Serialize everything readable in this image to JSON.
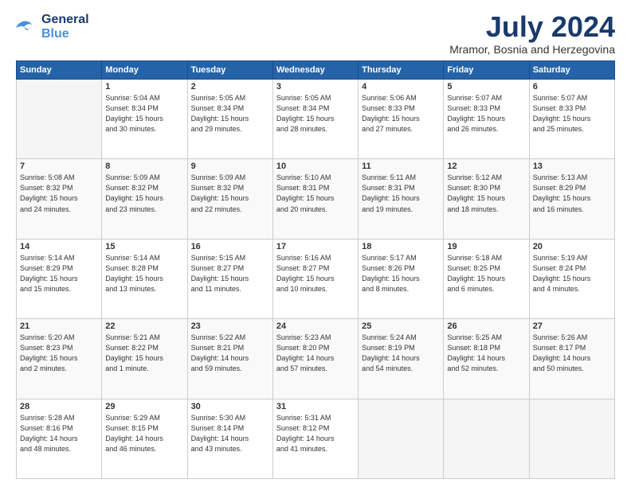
{
  "logo": {
    "line1": "General",
    "line2": "Blue"
  },
  "title": "July 2024",
  "location": "Mramor, Bosnia and Herzegovina",
  "weekdays": [
    "Sunday",
    "Monday",
    "Tuesday",
    "Wednesday",
    "Thursday",
    "Friday",
    "Saturday"
  ],
  "weeks": [
    [
      {
        "day": "",
        "info": ""
      },
      {
        "day": "1",
        "info": "Sunrise: 5:04 AM\nSunset: 8:34 PM\nDaylight: 15 hours\nand 30 minutes."
      },
      {
        "day": "2",
        "info": "Sunrise: 5:05 AM\nSunset: 8:34 PM\nDaylight: 15 hours\nand 29 minutes."
      },
      {
        "day": "3",
        "info": "Sunrise: 5:05 AM\nSunset: 8:34 PM\nDaylight: 15 hours\nand 28 minutes."
      },
      {
        "day": "4",
        "info": "Sunrise: 5:06 AM\nSunset: 8:33 PM\nDaylight: 15 hours\nand 27 minutes."
      },
      {
        "day": "5",
        "info": "Sunrise: 5:07 AM\nSunset: 8:33 PM\nDaylight: 15 hours\nand 26 minutes."
      },
      {
        "day": "6",
        "info": "Sunrise: 5:07 AM\nSunset: 8:33 PM\nDaylight: 15 hours\nand 25 minutes."
      }
    ],
    [
      {
        "day": "7",
        "info": "Sunrise: 5:08 AM\nSunset: 8:32 PM\nDaylight: 15 hours\nand 24 minutes."
      },
      {
        "day": "8",
        "info": "Sunrise: 5:09 AM\nSunset: 8:32 PM\nDaylight: 15 hours\nand 23 minutes."
      },
      {
        "day": "9",
        "info": "Sunrise: 5:09 AM\nSunset: 8:32 PM\nDaylight: 15 hours\nand 22 minutes."
      },
      {
        "day": "10",
        "info": "Sunrise: 5:10 AM\nSunset: 8:31 PM\nDaylight: 15 hours\nand 20 minutes."
      },
      {
        "day": "11",
        "info": "Sunrise: 5:11 AM\nSunset: 8:31 PM\nDaylight: 15 hours\nand 19 minutes."
      },
      {
        "day": "12",
        "info": "Sunrise: 5:12 AM\nSunset: 8:30 PM\nDaylight: 15 hours\nand 18 minutes."
      },
      {
        "day": "13",
        "info": "Sunrise: 5:13 AM\nSunset: 8:29 PM\nDaylight: 15 hours\nand 16 minutes."
      }
    ],
    [
      {
        "day": "14",
        "info": "Sunrise: 5:14 AM\nSunset: 8:29 PM\nDaylight: 15 hours\nand 15 minutes."
      },
      {
        "day": "15",
        "info": "Sunrise: 5:14 AM\nSunset: 8:28 PM\nDaylight: 15 hours\nand 13 minutes."
      },
      {
        "day": "16",
        "info": "Sunrise: 5:15 AM\nSunset: 8:27 PM\nDaylight: 15 hours\nand 11 minutes."
      },
      {
        "day": "17",
        "info": "Sunrise: 5:16 AM\nSunset: 8:27 PM\nDaylight: 15 hours\nand 10 minutes."
      },
      {
        "day": "18",
        "info": "Sunrise: 5:17 AM\nSunset: 8:26 PM\nDaylight: 15 hours\nand 8 minutes."
      },
      {
        "day": "19",
        "info": "Sunrise: 5:18 AM\nSunset: 8:25 PM\nDaylight: 15 hours\nand 6 minutes."
      },
      {
        "day": "20",
        "info": "Sunrise: 5:19 AM\nSunset: 8:24 PM\nDaylight: 15 hours\nand 4 minutes."
      }
    ],
    [
      {
        "day": "21",
        "info": "Sunrise: 5:20 AM\nSunset: 8:23 PM\nDaylight: 15 hours\nand 2 minutes."
      },
      {
        "day": "22",
        "info": "Sunrise: 5:21 AM\nSunset: 8:22 PM\nDaylight: 15 hours\nand 1 minute."
      },
      {
        "day": "23",
        "info": "Sunrise: 5:22 AM\nSunset: 8:21 PM\nDaylight: 14 hours\nand 59 minutes."
      },
      {
        "day": "24",
        "info": "Sunrise: 5:23 AM\nSunset: 8:20 PM\nDaylight: 14 hours\nand 57 minutes."
      },
      {
        "day": "25",
        "info": "Sunrise: 5:24 AM\nSunset: 8:19 PM\nDaylight: 14 hours\nand 54 minutes."
      },
      {
        "day": "26",
        "info": "Sunrise: 5:25 AM\nSunset: 8:18 PM\nDaylight: 14 hours\nand 52 minutes."
      },
      {
        "day": "27",
        "info": "Sunrise: 5:26 AM\nSunset: 8:17 PM\nDaylight: 14 hours\nand 50 minutes."
      }
    ],
    [
      {
        "day": "28",
        "info": "Sunrise: 5:28 AM\nSunset: 8:16 PM\nDaylight: 14 hours\nand 48 minutes."
      },
      {
        "day": "29",
        "info": "Sunrise: 5:29 AM\nSunset: 8:15 PM\nDaylight: 14 hours\nand 46 minutes."
      },
      {
        "day": "30",
        "info": "Sunrise: 5:30 AM\nSunset: 8:14 PM\nDaylight: 14 hours\nand 43 minutes."
      },
      {
        "day": "31",
        "info": "Sunrise: 5:31 AM\nSunset: 8:12 PM\nDaylight: 14 hours\nand 41 minutes."
      },
      {
        "day": "",
        "info": ""
      },
      {
        "day": "",
        "info": ""
      },
      {
        "day": "",
        "info": ""
      }
    ]
  ]
}
